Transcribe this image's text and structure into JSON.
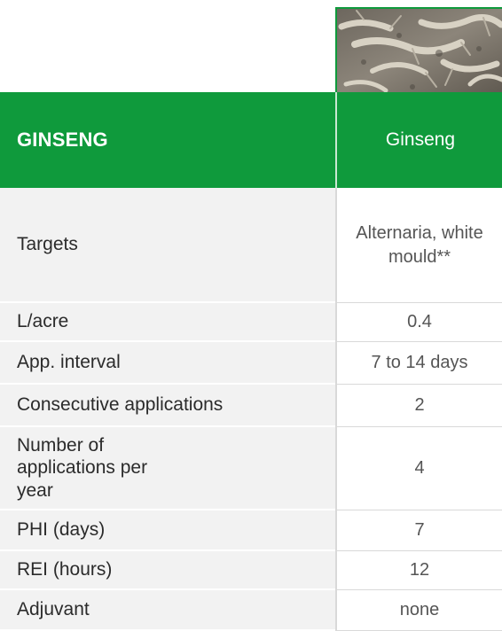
{
  "header": {
    "title": "GINSENG",
    "column": "Ginseng"
  },
  "photo": {
    "alt": "ginseng-roots-photo"
  },
  "rows": [
    {
      "label": "Targets",
      "value": "Alternaria, white mould**"
    },
    {
      "label": "L/acre",
      "value": "0.4"
    },
    {
      "label": "App. interval",
      "value": "7 to 14 days"
    },
    {
      "label": "Consecutive applications",
      "value": "2"
    },
    {
      "label": "Number of applications per year",
      "value": "4"
    },
    {
      "label": "PHI (days)",
      "value": "7"
    },
    {
      "label": "REI (hours)",
      "value": "12"
    },
    {
      "label": "Adjuvant",
      "value": "none"
    }
  ],
  "colors": {
    "brand_green": "#0f9a3c",
    "label_bg": "#f2f2f2",
    "divider": "#d9d9d9"
  }
}
